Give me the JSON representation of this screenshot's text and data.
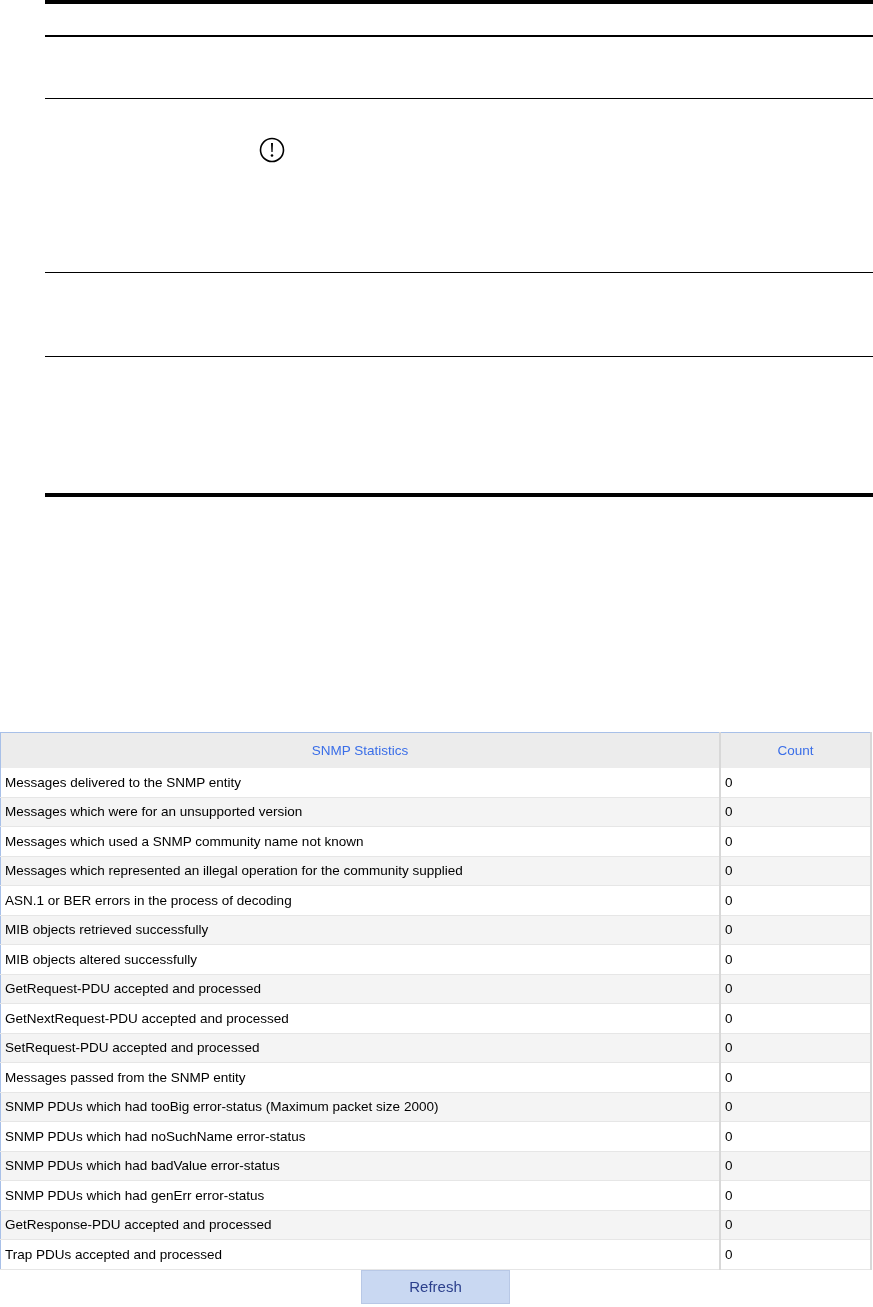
{
  "statistics_table": {
    "columns": [
      "SNMP Statistics",
      "Count"
    ],
    "rows": [
      {
        "statistic": "Messages delivered to the SNMP entity",
        "count": "0"
      },
      {
        "statistic": "Messages which were for an unsupported version",
        "count": "0"
      },
      {
        "statistic": "Messages which used a SNMP community name not known",
        "count": "0"
      },
      {
        "statistic": "Messages which represented an illegal operation for the community supplied",
        "count": "0"
      },
      {
        "statistic": "ASN.1 or BER errors in the process of decoding",
        "count": "0"
      },
      {
        "statistic": "MIB objects retrieved successfully",
        "count": "0"
      },
      {
        "statistic": "MIB objects altered successfully",
        "count": "0"
      },
      {
        "statistic": "GetRequest-PDU accepted and processed",
        "count": "0"
      },
      {
        "statistic": "GetNextRequest-PDU accepted and processed",
        "count": "0"
      },
      {
        "statistic": "SetRequest-PDU accepted and processed",
        "count": "0"
      },
      {
        "statistic": "Messages passed from the SNMP entity",
        "count": "0"
      },
      {
        "statistic": "SNMP PDUs which had tooBig error-status (Maximum packet size 2000)",
        "count": "0"
      },
      {
        "statistic": "SNMP PDUs which had noSuchName error-status",
        "count": "0"
      },
      {
        "statistic": "SNMP PDUs which had badValue error-status",
        "count": "0"
      },
      {
        "statistic": "SNMP PDUs which had genErr error-status",
        "count": "0"
      },
      {
        "statistic": "GetResponse-PDU accepted and processed",
        "count": "0"
      },
      {
        "statistic": "Trap PDUs accepted and processed",
        "count": "0"
      }
    ]
  },
  "buttons": [
    "Refresh"
  ]
}
